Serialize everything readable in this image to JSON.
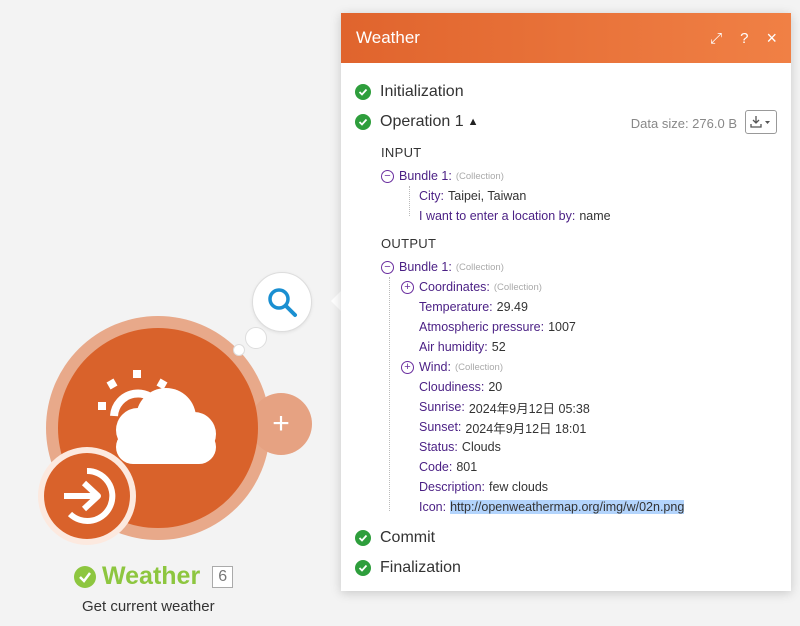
{
  "module": {
    "title": "Weather",
    "count": "6",
    "subtitle": "Get current weather",
    "add_symbol": "+",
    "colors": {
      "primary": "#d9622b",
      "accent": "#8dc63f"
    },
    "icons": [
      "weather-cloud-sun-icon",
      "arrow-right-circle-icon",
      "search-icon",
      "plus-icon",
      "check-icon"
    ]
  },
  "panel": {
    "title": "Weather",
    "tools": {
      "expand": "⤢",
      "help": "?",
      "close": "×"
    },
    "data_size": "Data size: 276.0 B",
    "phases": {
      "init": "Initialization",
      "op": "Operation 1",
      "commit": "Commit",
      "final": "Finalization"
    },
    "input": {
      "label": "INPUT",
      "bundle": {
        "key": "Bundle 1:",
        "type": "(Collection)"
      },
      "items": [
        {
          "key": "City:",
          "value": "Taipei, Taiwan"
        },
        {
          "key": "I want to enter a location by:",
          "value": "name"
        }
      ]
    },
    "output": {
      "label": "OUTPUT",
      "bundle": {
        "key": "Bundle 1:",
        "type": "(Collection)"
      },
      "coordinates": {
        "key": "Coordinates:",
        "type": "(Collection)"
      },
      "items_a": [
        {
          "key": "Temperature:",
          "value": "29.49"
        },
        {
          "key": "Atmospheric pressure:",
          "value": "1007"
        },
        {
          "key": "Air humidity:",
          "value": "52"
        }
      ],
      "wind": {
        "key": "Wind:",
        "type": "(Collection)"
      },
      "items_b": [
        {
          "key": "Cloudiness:",
          "value": "20"
        },
        {
          "key": "Sunrise:",
          "value": "2024年9月12日 05:38"
        },
        {
          "key": "Sunset:",
          "value": "2024年9月12日 18:01"
        },
        {
          "key": "Status:",
          "value": "Clouds"
        },
        {
          "key": "Code:",
          "value": "801"
        },
        {
          "key": "Description:",
          "value": "few clouds"
        },
        {
          "key": "Icon:",
          "value": "http://openweathermap.org/img/w/02n.png"
        }
      ]
    }
  }
}
